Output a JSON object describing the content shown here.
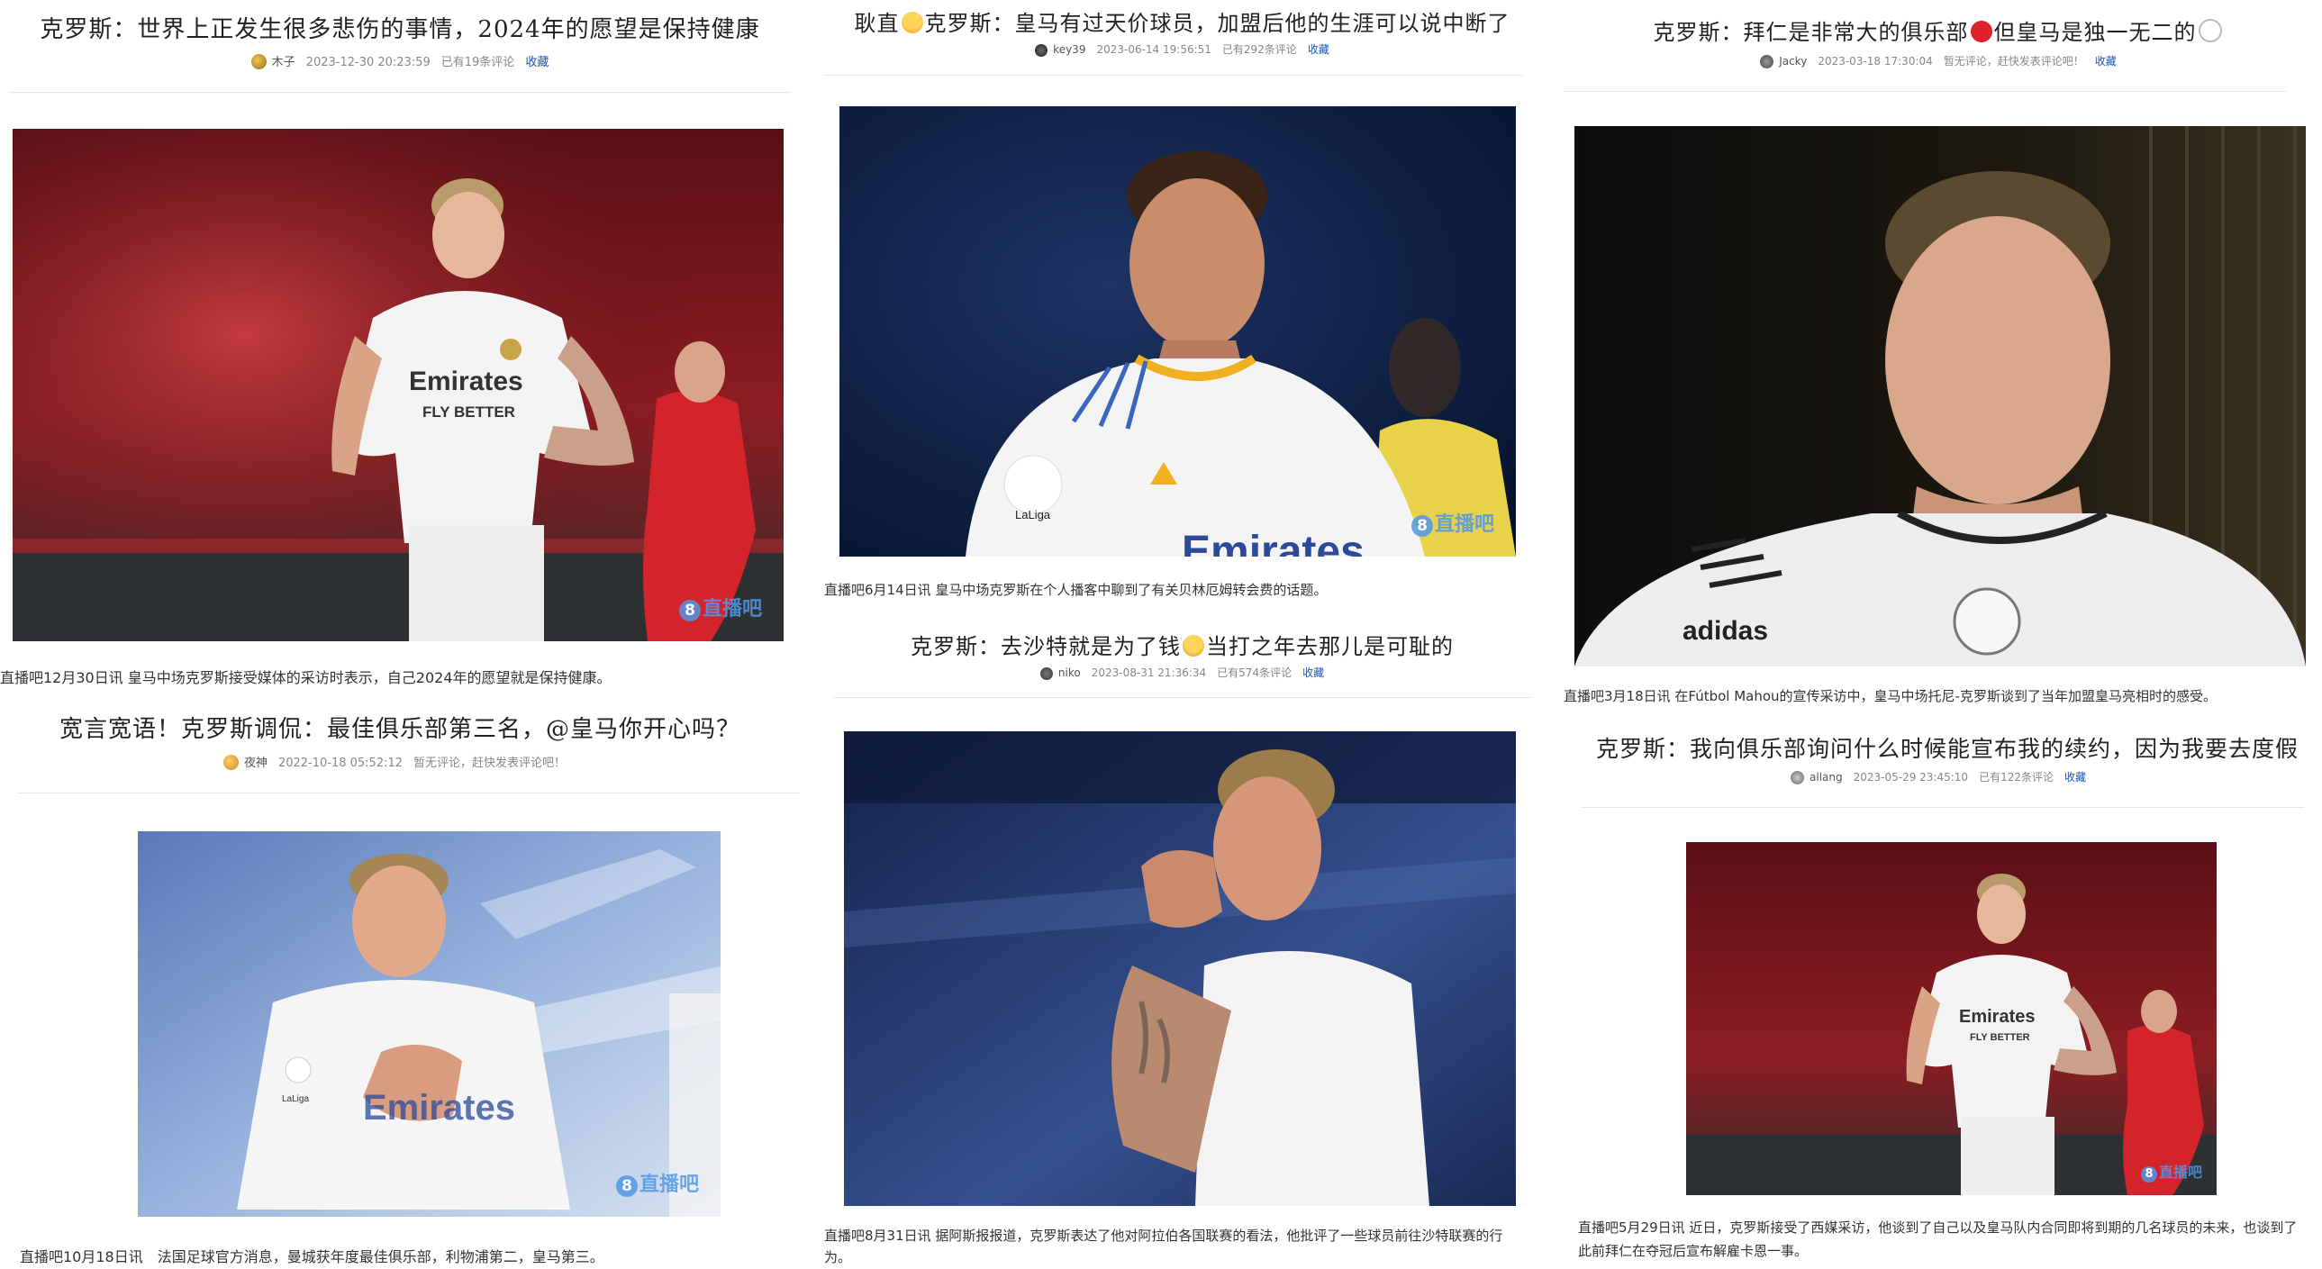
{
  "articles": [
    {
      "title": "克罗斯：世界上正发生很多悲伤的事情，2024年的愿望是保持健康",
      "author": "木子",
      "time": "2023-12-30 20:23:59",
      "comments": "已有19条评论",
      "fav": "收藏",
      "caption": "直播吧12月30日讯 皇马中场克罗斯接受媒体的采访时表示，自己2024年的愿望就是保持健康。"
    },
    {
      "title": "宽言宽语！克罗斯调侃：最佳俱乐部第三名，@皇马你开心吗？",
      "author": "夜神",
      "time": "2022-10-18 05:52:12",
      "comments": "暂无评论，赶快发表评论吧！",
      "fav": "",
      "caption": "直播吧10月18日讯　法国足球官方消息，曼城获年度最佳俱乐部，利物浦第二，皇马第三。"
    },
    {
      "title_a": "耿直",
      "title_b": "克罗斯：皇马有过天价球员，加盟后他的生涯可以说中断了",
      "author": "key39",
      "time": "2023-06-14 19:56:51",
      "comments": "已有292条评论",
      "fav": "收藏",
      "caption": "直播吧6月14日讯 皇马中场克罗斯在个人播客中聊到了有关贝林厄姆转会费的话题。"
    },
    {
      "title_a": "克罗斯：去沙特就是为了钱",
      "title_b": "当打之年去那儿是可耻的",
      "author": "niko",
      "time": "2023-08-31 21:36:34",
      "comments": "已有574条评论",
      "fav": "收藏",
      "caption": "直播吧8月31日讯 据阿斯报报道，克罗斯表达了他对阿拉伯各国联赛的看法，他批评了一些球员前往沙特联赛的行为。"
    },
    {
      "title_a": "克罗斯：拜仁是非常大的俱乐部",
      "title_b": "但皇马是独一无二的",
      "author": "Jacky",
      "time": "2023-03-18 17:30:04",
      "comments": "暂无评论，赶快发表评论吧！",
      "fav": "收藏",
      "caption": "直播吧3月18日讯 在Fútbol Mahou的宣传采访中，皇马中场托尼-克罗斯谈到了当年加盟皇马亮相时的感受。"
    },
    {
      "title": "克罗斯：我向俱乐部询问什么时候能宣布我的续约，因为我要去度假",
      "author": "allang",
      "time": "2023-05-29 23:45:10",
      "comments": "已有122条评论",
      "fav": "收藏",
      "caption": "直播吧5月29日讯 近日，克罗斯接受了西媒采访，他谈到了自己以及皇马队内合同即将到期的几名球员的未来，也谈到了此前拜仁在夺冠后宣布解雇卡恩一事。"
    }
  ],
  "jersey": {
    "sponsor": "Emirates",
    "sponsor_sub": "FLY BETTER",
    "brand": "adidas",
    "laliga": "LaLiga",
    "watermark": "直播吧",
    "wm_num": "8"
  },
  "colors": {
    "link": "#1a55b4",
    "meta": "#888888",
    "divider": "#e6e6e6",
    "red_dot": "#e0202a"
  }
}
